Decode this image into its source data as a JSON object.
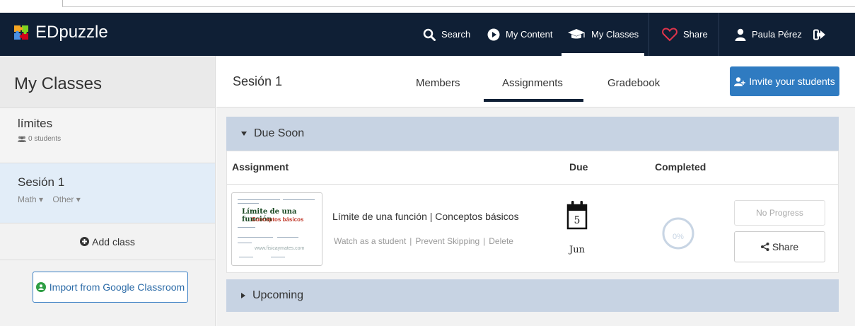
{
  "app": {
    "logo_text": "EDpuzzle"
  },
  "nav": {
    "search": "Search",
    "my_content": "My Content",
    "my_classes": "My Classes",
    "share": "Share",
    "user_name": "Paula Pérez",
    "heart_color": "#e0344b"
  },
  "sidebar": {
    "title": "My Classes",
    "classes": [
      {
        "name": "límites",
        "students": "0 students"
      },
      {
        "name": "Sesión 1",
        "subject": "Math",
        "grade": "Other"
      }
    ],
    "add_class": "Add class",
    "import_button": "Import from Google Classroom"
  },
  "header": {
    "class_title": "Sesión 1",
    "tabs": [
      "Members",
      "Assignments",
      "Gradebook"
    ],
    "active_tab": "Assignments",
    "invite_button": "Invite your students"
  },
  "due_soon": {
    "label": "Due Soon",
    "columns": {
      "assignment": "Assignment",
      "due": "Due",
      "completed": "Completed"
    },
    "assignment": {
      "thumb_title": "Límite de una función",
      "thumb_subtitle": "Conceptos básicos",
      "thumb_watermark": "www.fisicaymates.com",
      "title": "Límite de una función | Conceptos básicos",
      "actions": [
        "Watch as a student",
        "Prevent Skipping",
        "Delete"
      ],
      "due_day": "5",
      "due_month": "Jun",
      "completed_pct": "0%",
      "completed_fraction": 0,
      "no_progress": "No Progress",
      "share": "Share"
    }
  },
  "upcoming": {
    "label": "Upcoming"
  }
}
